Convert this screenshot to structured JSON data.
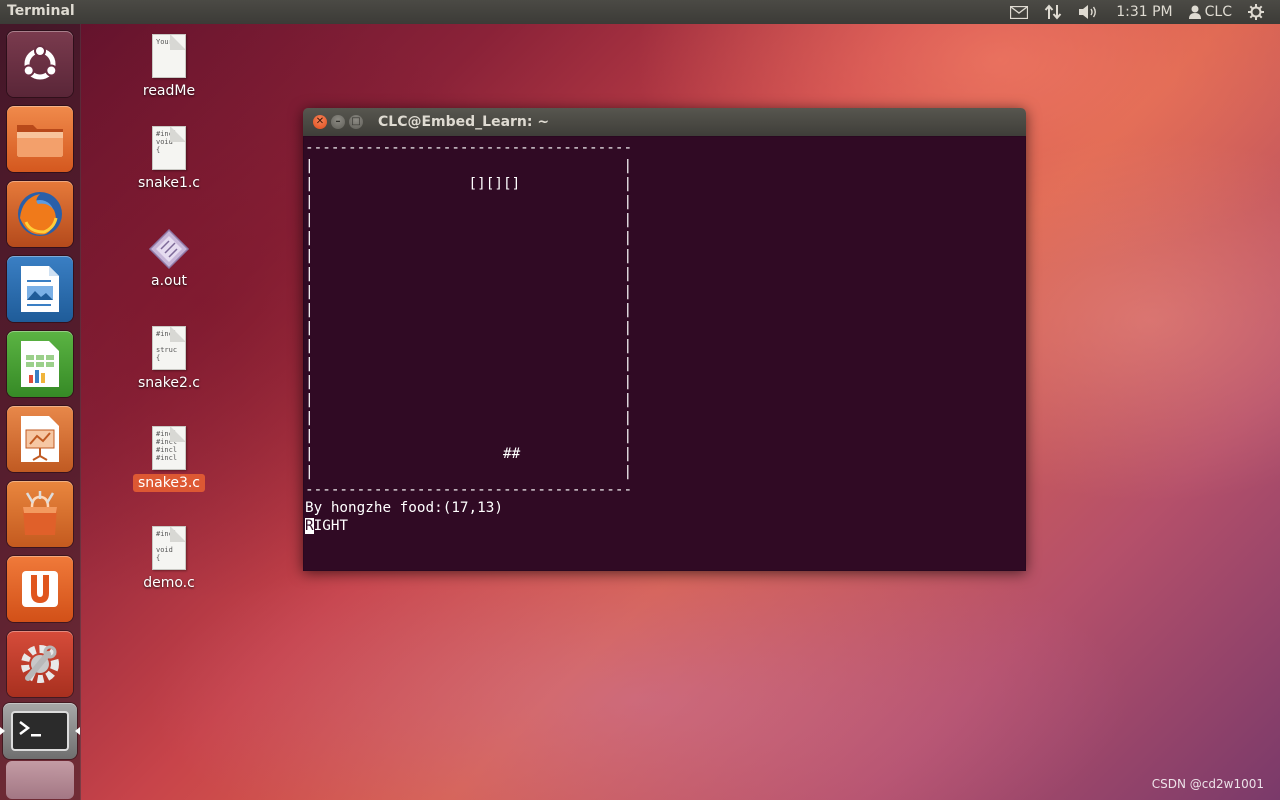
{
  "top_panel": {
    "app_title": "Terminal",
    "clock": "1:31 PM",
    "user": "CLC",
    "icons": [
      "mail-icon",
      "network-icon",
      "volume-icon",
      "user-icon",
      "gear-icon"
    ]
  },
  "launcher": {
    "items": [
      {
        "name": "dash-home",
        "icon": "ubuntu-logo-icon"
      },
      {
        "name": "files",
        "icon": "folder-icon"
      },
      {
        "name": "firefox",
        "icon": "firefox-icon"
      },
      {
        "name": "libreoffice-writer",
        "icon": "writer-icon"
      },
      {
        "name": "libreoffice-calc",
        "icon": "calc-icon"
      },
      {
        "name": "libreoffice-impress",
        "icon": "impress-icon"
      },
      {
        "name": "software-center",
        "icon": "shopping-bag-icon"
      },
      {
        "name": "ubuntu-one",
        "icon": "ubuntu-one-icon"
      },
      {
        "name": "system-settings",
        "icon": "settings-icon"
      },
      {
        "name": "terminal",
        "icon": "terminal-icon",
        "running": true
      }
    ]
  },
  "desktop": {
    "files": [
      {
        "label": "readMe",
        "preview": "Your",
        "kind": "text"
      },
      {
        "label": "snake1.c",
        "preview": "#incl\nvoid\n{",
        "kind": "text"
      },
      {
        "label": "a.out",
        "preview": "",
        "kind": "executable"
      },
      {
        "label": "snake2.c",
        "preview": "#incl\n\nstruc\n{",
        "kind": "text"
      },
      {
        "label": "snake3.c",
        "preview": "#incl\n#incl\n#incl\n#incl",
        "kind": "text",
        "selected": true
      },
      {
        "label": "demo.c",
        "preview": "#incl\n\nvoid\n{",
        "kind": "text"
      }
    ]
  },
  "terminal": {
    "title": "CLC@Embed_Learn: ~",
    "close_glyph": "✕",
    "minimize_glyph": "–",
    "maximize_glyph": "□",
    "screen": "--------------------------------------\n|                                    |\n|                  [][][]            |\n|                                    |\n|                                    |\n|                                    |\n|                                    |\n|                                    |\n|                                    |\n|                                    |\n|                                    |\n|                                    |\n|                                    |\n|                                    |\n|                                    |\n|                                    |\n|                                    |\n|                      ##            |\n|                                    |\n--------------------------------------",
    "status_line": "By hongzhe food:(17,13)",
    "cursor_char": "R",
    "direction_rest": "IGHT"
  },
  "watermark": "CSDN @cd2w1001"
}
